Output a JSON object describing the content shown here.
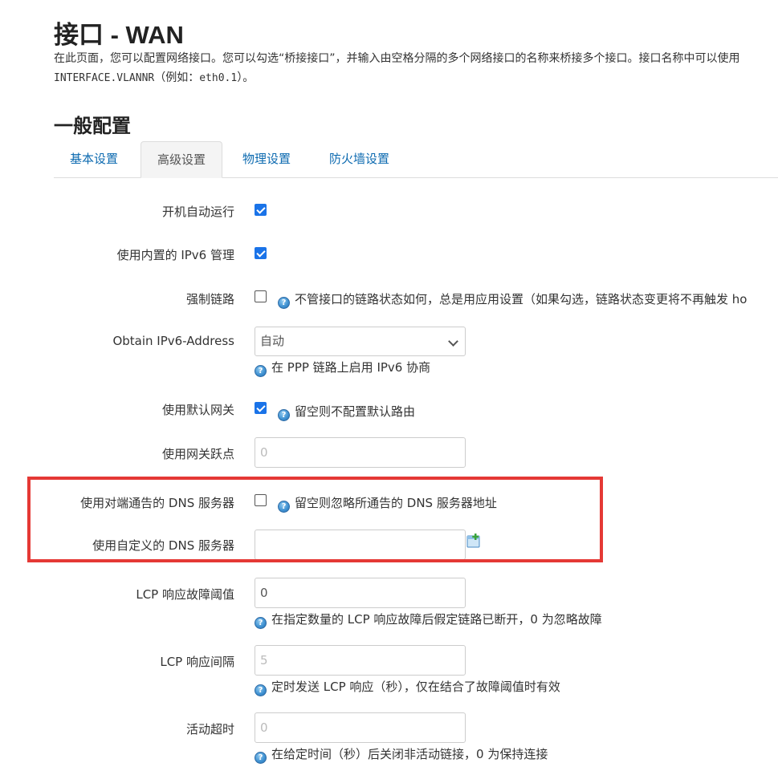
{
  "header": {
    "title": "接口 - WAN",
    "desc_line1": "在此页面，您可以配置网络接口。您可以勾选“桥接接口”，并输入由空格分隔的多个网络接口的名称来桥接多个接口。接口名称中可以使用",
    "desc_line2_mono": "INTERFACE.VLANNR",
    "desc_line2_text": "（例如：",
    "desc_line2_mono2": "eth0.1",
    "desc_line2_tail": "）。"
  },
  "section": {
    "title": "一般配置"
  },
  "tabs": [
    {
      "label": "基本设置"
    },
    {
      "label": "高级设置"
    },
    {
      "label": "物理设置"
    },
    {
      "label": "防火墙设置"
    }
  ],
  "fields": {
    "autostart": {
      "label": "开机自动运行",
      "checked": true
    },
    "ipv6_mgmt": {
      "label": "使用内置的 IPv6 管理",
      "checked": true
    },
    "force_link": {
      "label": "强制链路",
      "checked": false,
      "help": "不管接口的链路状态如何，总是用应用设置（如果勾选，链路状态变更将不再触发 ho"
    },
    "obtain_ipv6": {
      "label": "Obtain IPv6-Address",
      "value": "自动",
      "help": "在 PPP 链路上启用 IPv6 协商"
    },
    "default_gw": {
      "label": "使用默认网关",
      "checked": true,
      "help": "留空则不配置默认路由"
    },
    "gw_metric": {
      "label": "使用网关跃点",
      "placeholder": "0"
    },
    "peer_dns": {
      "label": "使用对端通告的 DNS 服务器",
      "checked": false,
      "help": "留空则忽略所通告的 DNS 服务器地址"
    },
    "custom_dns": {
      "label": "使用自定义的 DNS 服务器",
      "value": ""
    },
    "lcp_threshold": {
      "label": "LCP 响应故障阈值",
      "value": "0",
      "help": "在指定数量的 LCP 响应故障后假定链路已断开，0 为忽略故障"
    },
    "lcp_interval": {
      "label": "LCP 响应间隔",
      "placeholder": "5",
      "help": "定时发送 LCP 响应（秒），仅在结合了故障阈值时有效"
    },
    "idle_timeout": {
      "label": "活动超时",
      "placeholder": "0",
      "help": "在给定时间（秒）后关闭非活动链接，0 为保持连接"
    }
  },
  "colors": {
    "accent": "#1a73e8",
    "link": "#0c6ab0",
    "highlight": "#e53935"
  }
}
